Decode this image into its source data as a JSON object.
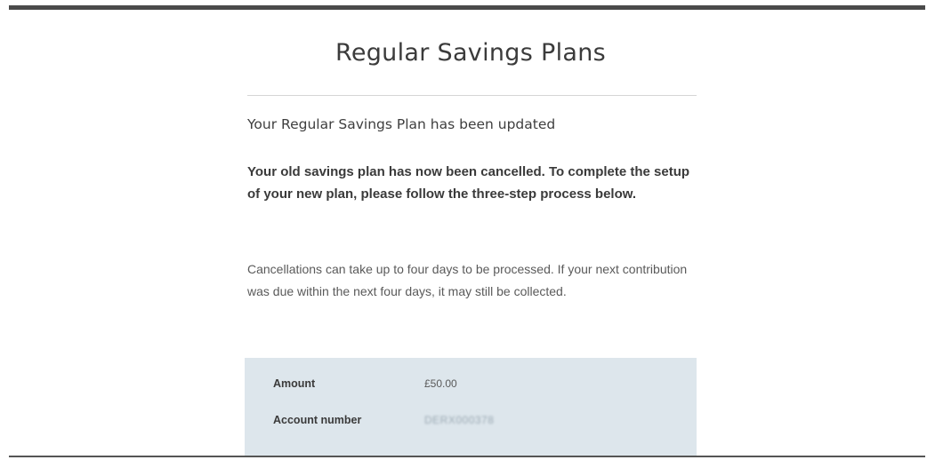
{
  "page": {
    "title": "Regular Savings Plans"
  },
  "confirmation": {
    "subheading": "Your Regular Savings Plan has been updated",
    "bold_message": "Your old savings plan has now been cancelled. To complete the setup of your new plan, please follow the three-step process below.",
    "info_message": "Cancellations can take up to four days to be processed. If your next contribution was due within the next four days, it may still be collected."
  },
  "details": {
    "rows": [
      {
        "label": "Amount",
        "value": "£50.00"
      },
      {
        "label": "Account number",
        "value": "DERX000378"
      }
    ]
  },
  "colors": {
    "panel_background": "#dde6ec",
    "top_bar": "#4a4a4a"
  }
}
